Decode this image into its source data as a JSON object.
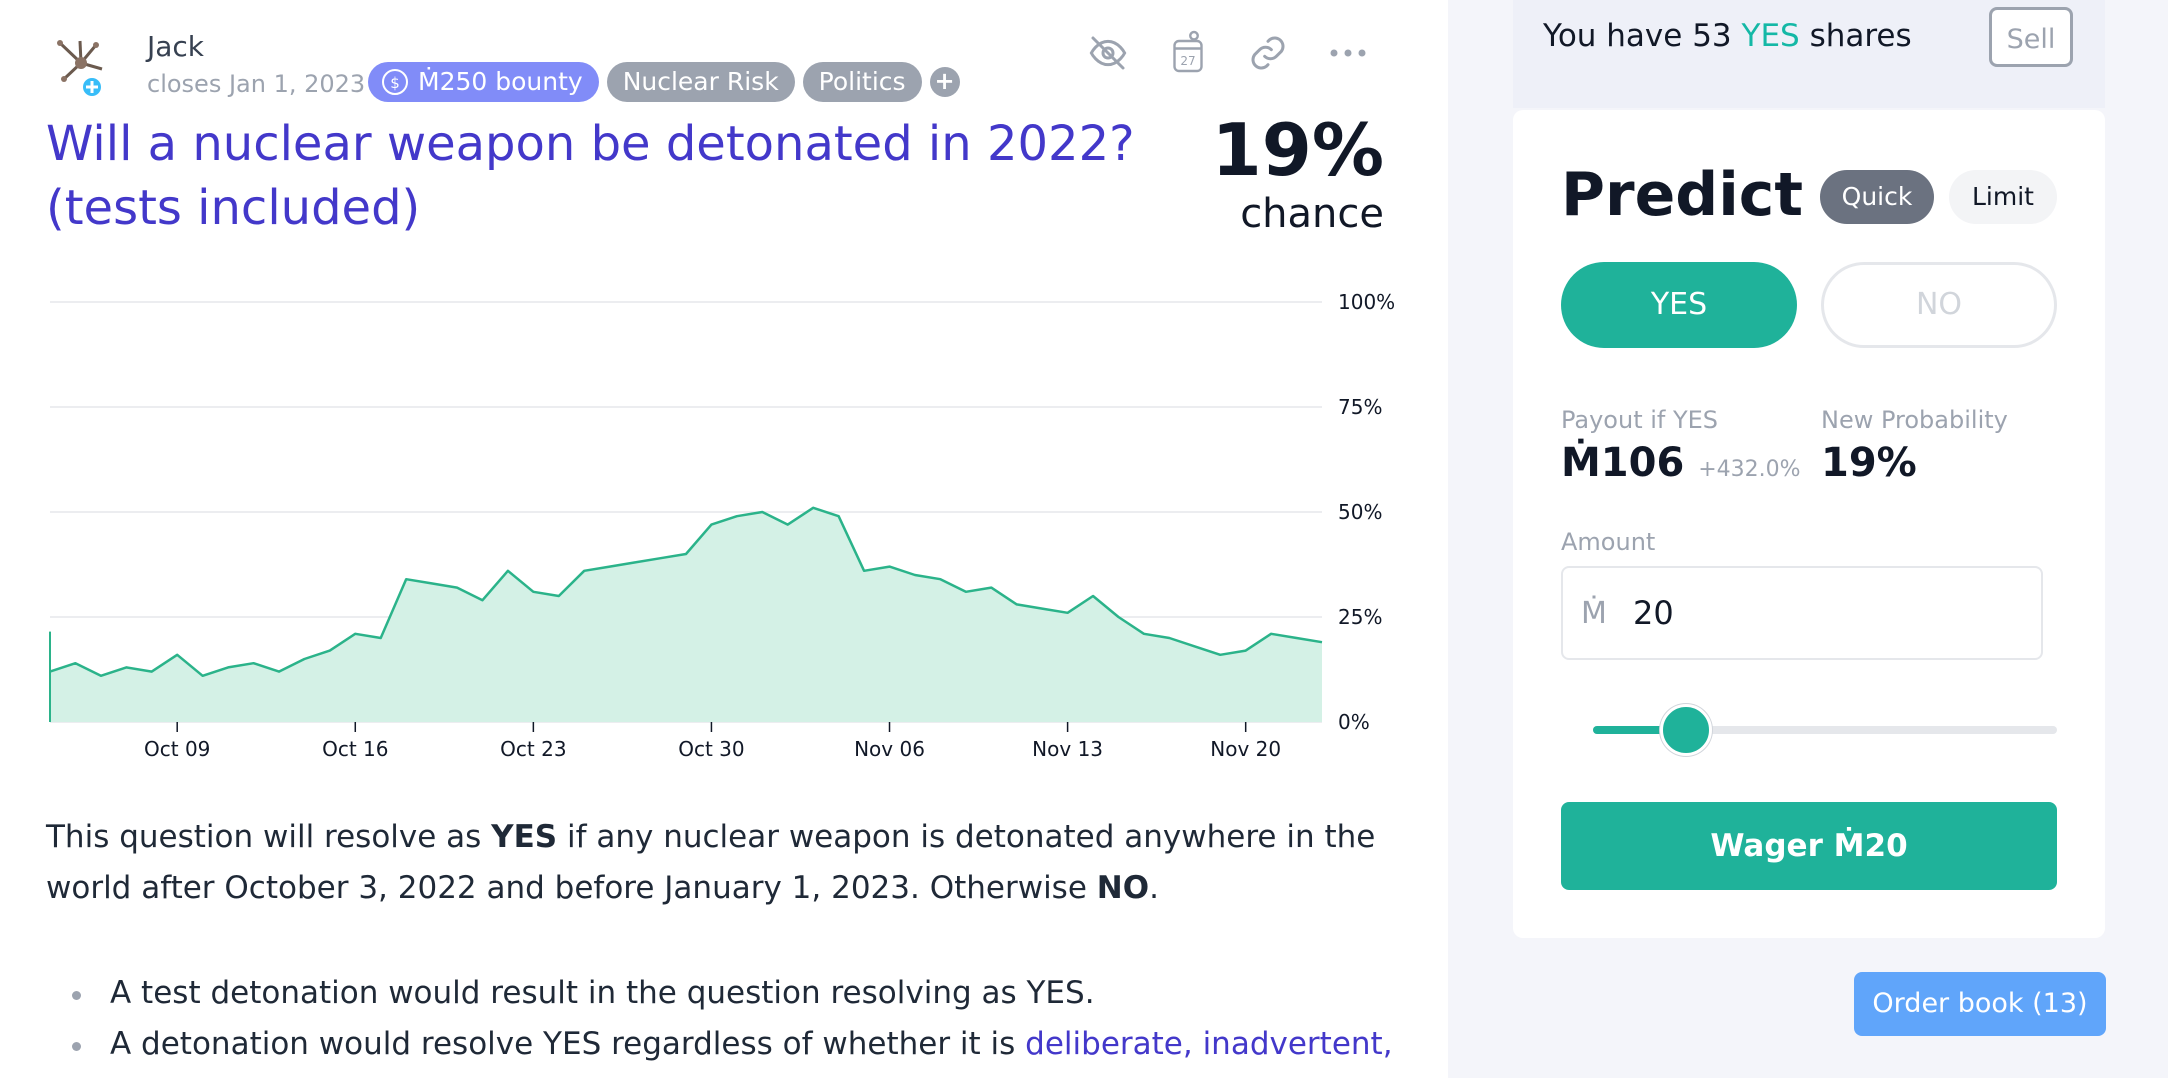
{
  "market": {
    "creator_name": "Jack",
    "closes_text": "closes Jan 1, 2023",
    "tags": [
      {
        "label": "Ṁ250 bounty"
      },
      {
        "label": "Nuclear Risk"
      },
      {
        "label": "Politics"
      }
    ],
    "add_tag_label": "+",
    "title": "Will a nuclear weapon be detonated in 2022? (tests included)",
    "probability": "19%",
    "probability_label": "chance",
    "toolbar": {
      "hide_icon": "eye-off-icon",
      "calendar_icon": "calendar-icon",
      "calendar_day": "27",
      "link_icon": "link-icon",
      "more_icon": "more-icon"
    }
  },
  "description": {
    "p1_a": "This question will resolve as ",
    "p1_yes": "YES",
    "p1_b": " if any nuclear weapon is detonated anywhere in the world after October 3, 2022 and before January 1, 2023. Otherwise ",
    "p1_no": "NO",
    "p1_c": ".",
    "bullets": [
      {
        "text": "A test detonation would result in the question resolving as YES."
      },
      {
        "text_a": "A detonation would resolve YES regardless of whether it is ",
        "link": "deliberate, inadvertent,"
      }
    ]
  },
  "chart_data": {
    "type": "area",
    "title": "",
    "xlabel": "",
    "ylabel": "",
    "ylim": [
      0,
      100
    ],
    "yticks": [
      "0%",
      "25%",
      "50%",
      "75%",
      "100%"
    ],
    "xticks": [
      "Oct 09",
      "Oct 16",
      "Oct 23",
      "Oct 30",
      "Nov 06",
      "Nov 13",
      "Nov 20"
    ],
    "x": [
      "Oct 04",
      "Oct 05",
      "Oct 06",
      "Oct 07",
      "Oct 08",
      "Oct 09",
      "Oct 10",
      "Oct 11",
      "Oct 12",
      "Oct 13",
      "Oct 14",
      "Oct 15",
      "Oct 16",
      "Oct 17",
      "Oct 18",
      "Oct 19",
      "Oct 20",
      "Oct 21",
      "Oct 22",
      "Oct 23",
      "Oct 24",
      "Oct 25",
      "Oct 26",
      "Oct 27",
      "Oct 28",
      "Oct 29",
      "Oct 30",
      "Oct 31",
      "Nov 01",
      "Nov 02",
      "Nov 03",
      "Nov 04",
      "Nov 05",
      "Nov 06",
      "Nov 07",
      "Nov 08",
      "Nov 09",
      "Nov 10",
      "Nov 11",
      "Nov 12",
      "Nov 13",
      "Nov 14",
      "Nov 15",
      "Nov 16",
      "Nov 17",
      "Nov 18",
      "Nov 19",
      "Nov 20",
      "Nov 21",
      "Nov 22",
      "Nov 23"
    ],
    "values": [
      12,
      14,
      11,
      13,
      12,
      16,
      11,
      13,
      14,
      12,
      15,
      17,
      21,
      20,
      34,
      33,
      32,
      29,
      36,
      31,
      30,
      36,
      37,
      38,
      39,
      40,
      47,
      49,
      50,
      47,
      51,
      49,
      36,
      37,
      35,
      34,
      31,
      32,
      28,
      27,
      26,
      30,
      25,
      21,
      20,
      18,
      16,
      17,
      21,
      20,
      19
    ],
    "color": "#2bb38a",
    "fill": "#d4f1e6",
    "grid": true
  },
  "panel": {
    "shares_prefix": "You have 53 ",
    "shares_yes": "YES",
    "shares_suffix": " shares",
    "sell_label": "Sell",
    "predict_title": "Predict",
    "mode_quick": "Quick",
    "mode_limit": "Limit",
    "yes_label": "YES",
    "no_label": "NO",
    "payout_label": "Payout if YES",
    "payout_value": "Ṁ106",
    "payout_pct": "+432.0%",
    "new_prob_label": "New Probability",
    "new_prob_value": "19%",
    "amount_label": "Amount",
    "currency_symbol": "Ṁ",
    "amount_value": "20",
    "slider_fraction": 0.2,
    "wager_label": "Wager Ṁ20",
    "order_book_label": "Order book (13)"
  },
  "colors": {
    "title": "#4338ca",
    "accent_green": "#1fb29a",
    "yes_text": "#14b8a6",
    "order_book": "#60a5fa"
  }
}
